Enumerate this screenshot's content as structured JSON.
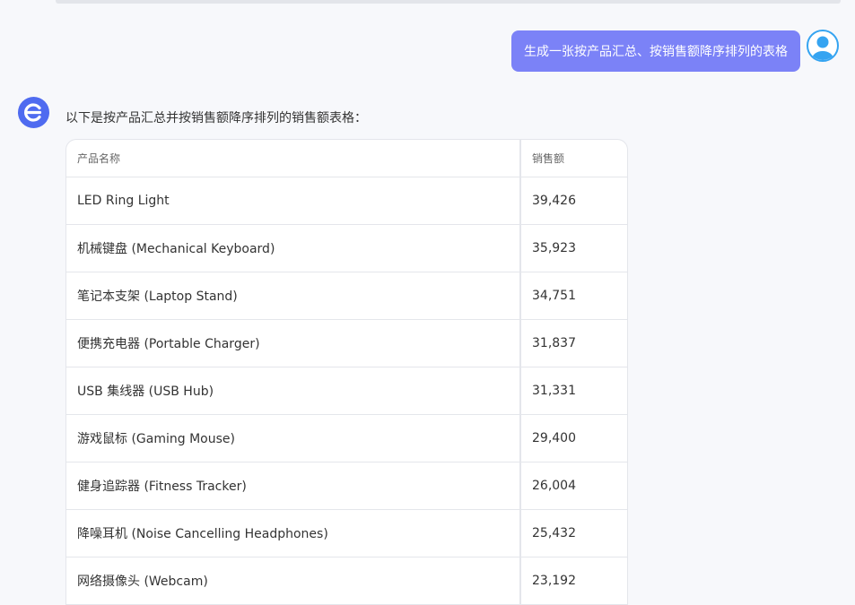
{
  "user_message": "生成一张按产品汇总、按销售额降序排列的表格",
  "bot_intro": "以下是按产品汇总并按销售额降序排列的销售额表格：",
  "colors": {
    "accent": "#7b82f7",
    "brand": "#4f6bf0",
    "avatar": "#35a4f1"
  },
  "table": {
    "headers": [
      "产品名称",
      "销售额"
    ],
    "rows": [
      [
        "LED Ring Light",
        "39,426"
      ],
      [
        "机械键盘 (Mechanical Keyboard)",
        "35,923"
      ],
      [
        "笔记本支架 (Laptop Stand)",
        "34,751"
      ],
      [
        "便携充电器 (Portable Charger)",
        "31,837"
      ],
      [
        "USB 集线器 (USB Hub)",
        "31,331"
      ],
      [
        "游戏鼠标 (Gaming Mouse)",
        "29,400"
      ],
      [
        "健身追踪器 (Fitness Tracker)",
        "26,004"
      ],
      [
        "降噪耳机 (Noise Cancelling Headphones)",
        "25,432"
      ],
      [
        "网络摄像头 (Webcam)",
        "23,192"
      ]
    ]
  }
}
